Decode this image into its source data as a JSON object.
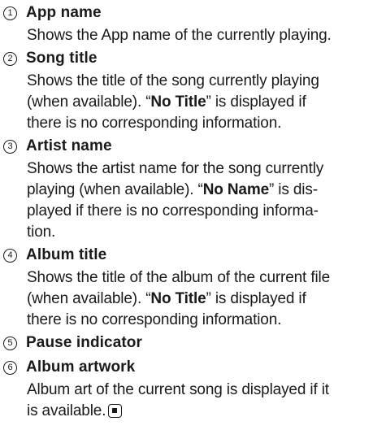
{
  "items": [
    {
      "num": "1",
      "title": "App name",
      "lines": [
        "Shows the App name of the currently playing."
      ]
    },
    {
      "num": "2",
      "title": "Song title",
      "lines": [
        "Shows the title of the song currently playing",
        "(when available). “",
        "There is no corresponding information."
      ],
      "pre": "(when available). “",
      "bold": "No Title",
      "post": "” is displayed if",
      "last": "there is no corresponding information.",
      "first": "Shows the title of the song currently playing"
    },
    {
      "num": "3",
      "title": "Artist name",
      "first": "Shows the artist name for the song currently",
      "pre": "playing (when available). “",
      "bold": "No Name",
      "post": "” is dis-",
      "line3": "played if there is no corresponding informa-",
      "last": "tion."
    },
    {
      "num": "4",
      "title": "Album title",
      "first": "Shows the title of the album of the current file",
      "pre": "(when available). “",
      "bold": "No Title",
      "post": "” is displayed if",
      "last": "there is no corresponding information."
    },
    {
      "num": "5",
      "title": "Pause indicator"
    },
    {
      "num": "6",
      "title": "Album artwork",
      "first": "Album art of the current song is displayed if it",
      "last": "is available."
    }
  ]
}
